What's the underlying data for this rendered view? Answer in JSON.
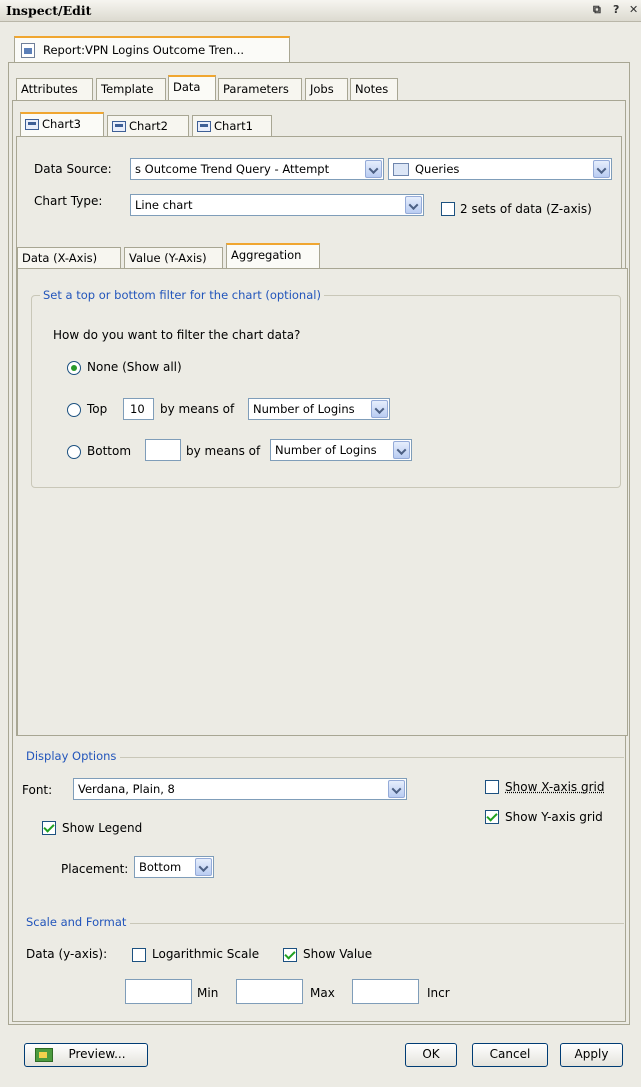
{
  "window": {
    "title": "Inspect/Edit",
    "controls": [
      "⧉",
      "?",
      "✕"
    ]
  },
  "report_tab": {
    "label": "Report:VPN Logins Outcome Tren..."
  },
  "main_tabs": [
    "Attributes",
    "Template",
    "Data",
    "Parameters",
    "Jobs",
    "Notes"
  ],
  "chart_tabs": [
    "Chart3",
    "Chart2",
    "Chart1"
  ],
  "data_source": {
    "label": "Data Source:",
    "value": "s Outcome Trend Query - Attempt",
    "category_value": "Queries"
  },
  "chart_type": {
    "label": "Chart Type:",
    "value": "Line chart",
    "z_axis_label": "2 sets of data (Z-axis)",
    "z_axis_checked": false
  },
  "sub_tabs": [
    "Data (X-Axis)",
    "Value (Y-Axis)",
    "Aggregation"
  ],
  "filter": {
    "group_title": "Set a top or bottom filter for the chart (optional)",
    "question": "How do you want to filter the chart data?",
    "none_label": "None (Show all)",
    "top_label": "Top",
    "top_value": "10",
    "bottom_label": "Bottom",
    "bottom_value": "",
    "by_means_of": "by means of",
    "top_measure": "Number of Logins",
    "bottom_measure": "Number of Logins",
    "selected": "none"
  },
  "display_options": {
    "title": "Display Options",
    "font_label": "Font:",
    "font_value": "Verdana, Plain, 8",
    "show_legend_label": "Show Legend",
    "show_legend": true,
    "placement_label": "Placement:",
    "placement_value": "Bottom",
    "show_x_grid_label": "Show X-axis grid",
    "show_x_grid": false,
    "show_y_grid_label": "Show Y-axis grid",
    "show_y_grid": true
  },
  "scale_format": {
    "title": "Scale and Format",
    "data_y_label": "Data (y-axis):",
    "log_scale_label": "Logarithmic Scale",
    "log_scale": false,
    "show_value_label": "Show Value",
    "show_value": true,
    "min_label": "Min",
    "max_label": "Max",
    "incr_label": "Incr",
    "min_value": "",
    "max_value": "",
    "incr_value": ""
  },
  "buttons": {
    "preview": "Preview...",
    "ok": "OK",
    "cancel": "Cancel",
    "apply": "Apply"
  }
}
